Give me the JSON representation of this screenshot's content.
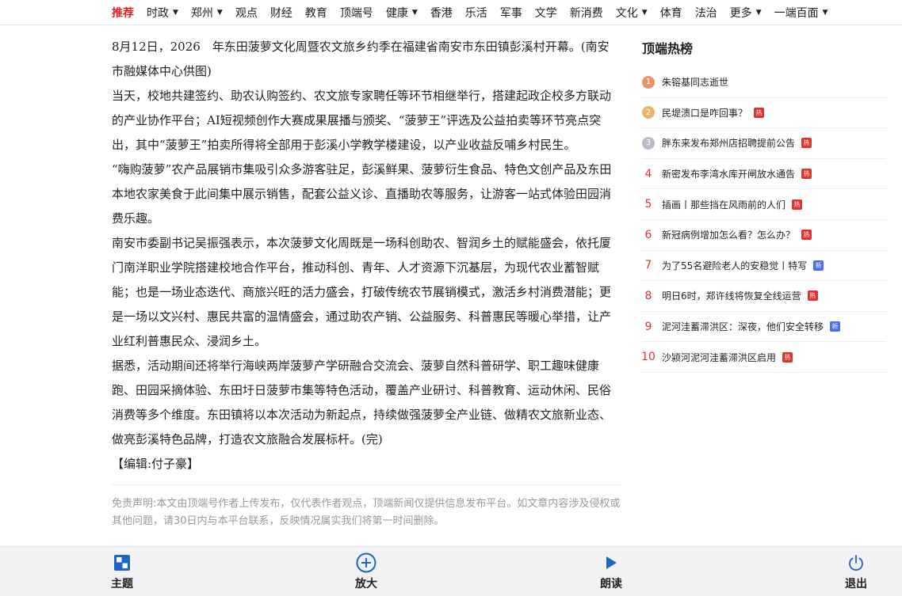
{
  "nav": {
    "items": [
      {
        "label": "推荐"
      },
      {
        "label": "时政"
      },
      {
        "label": "郑州"
      },
      {
        "label": "观点"
      },
      {
        "label": "财经"
      },
      {
        "label": "教育"
      },
      {
        "label": "顶端号"
      },
      {
        "label": "健康"
      },
      {
        "label": "香港"
      },
      {
        "label": "乐活"
      },
      {
        "label": "军事"
      },
      {
        "label": "文学"
      },
      {
        "label": "新消费"
      },
      {
        "label": "文化"
      },
      {
        "label": "体育"
      },
      {
        "label": "法治"
      },
      {
        "label": "更多"
      },
      {
        "label": "一端百面"
      }
    ]
  },
  "article": {
    "paragraphs": [
      "8月12日，2026　年东田菠萝文化周暨农文旅乡约季在福建省南安市东田镇彭溪村开幕。(南安市融媒体中心供图)",
      "当天，校地共建签约、助农认购签约、农文旅专家聘任等环节相继举行，搭建起政企校多方联动的产业协作平台；AI短视频创作大赛成果展播与颁奖、“菠萝王”评选及公益拍卖等环节亮点突出，其中“菠萝王”拍卖所得将全部用于彭溪小学教学楼建设，以产业收益反哺乡村民生。",
      "“嗨购菠萝”农产品展销市集吸引众多游客驻足，彭溪鲜果、菠萝衍生食品、特色文创产品及东田本地农家美食于此间集中展示销售，配套公益义诊、直播助农等服务，让游客一站式体验田园消费乐趣。",
      "南安市委副书记吴振强表示，本次菠萝文化周既是一场科创助农、智润乡土的赋能盛会，依托厦门南洋职业学院搭建校地合作平台，推动科创、青年、人才资源下沉基层，为现代农业蓄智赋能；也是一场业态迭代、商旅兴旺的活力盛会，打破传统农节展销模式，激活乡村消费潜能；更是一场以文兴村、惠民共富的温情盛会，通过助农产销、公益服务、科普惠民等暖心举措，让产业红利普惠民众、浸润乡土。",
      "据悉，活动期间还将举行海峡两岸菠萝产学研融合交流会、菠萝自然科普研学、职工趣味健康跑、田园采摘体验、东田圩日菠萝市集等特色活动，覆盖产业研讨、科普教育、运动休闲、民俗消费等多个维度。东田镇将以本次活动为新起点，持续做强菠萝全产业链、做精农文旅新业态、做亮彭溪特色品牌，打造农文旅融合发展标杆。(完)"
    ],
    "editor": "【编辑:付子豪】",
    "disclaimer": "免责声明:本文由顶端号作者上传发布，仅代表作者观点，顶端新闻仅提供信息发布平台。如文章内容涉及侵权或其他问题，请30日内与本平台联系，反映情况属实我们将第一时间删除。"
  },
  "hot": {
    "title": "顶端热榜",
    "items": [
      {
        "rank": "1",
        "text": "朱镕基同志逝世",
        "badge": ""
      },
      {
        "rank": "2",
        "text": "民堤溃口是咋回事？",
        "badge": "热"
      },
      {
        "rank": "3",
        "text": "胖东来发布郑州店招聘提前公告",
        "badge": "热"
      },
      {
        "rank": "4",
        "text": "新密发布李湾水库开闸放水通告",
        "badge": "热"
      },
      {
        "rank": "5",
        "text": "插画丨那些挡在风雨前的人们",
        "badge": "热"
      },
      {
        "rank": "6",
        "text": "新冠病例增加怎么看？怎么办？",
        "badge": "热"
      },
      {
        "rank": "7",
        "text": "为了55名避险老人的安稳觉丨特写",
        "badge": "新"
      },
      {
        "rank": "8",
        "text": "明日6时，郑许线将恢复全线运营",
        "badge": "热"
      },
      {
        "rank": "9",
        "text": "泥河洼蓄滞洪区：深夜，他们安全转移",
        "badge": "新"
      },
      {
        "rank": "10",
        "text": "沙颍河泥河洼蓄滞洪区启用",
        "badge": "热"
      }
    ]
  },
  "toolbar": {
    "theme_label": "主题",
    "zoom_label": "放大",
    "read_label": "朗读",
    "exit_label": "退出"
  },
  "colors": {
    "accent": "#d22222",
    "rank_red": "#e0322f",
    "icon_blue": "#1a66c9",
    "badge_new": "#4a6ef0"
  }
}
